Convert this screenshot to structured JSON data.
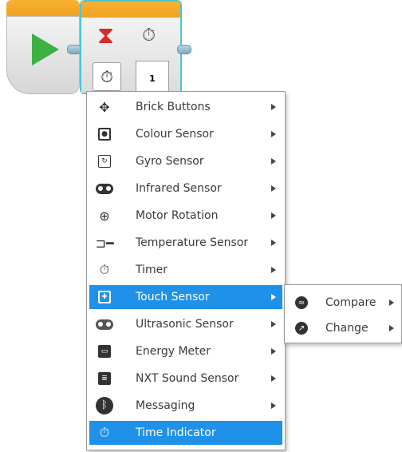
{
  "program": {
    "wait_block_param": "1",
    "colors": {
      "start_green": "#3cb043",
      "block_orange": "#f0a020",
      "selection": "#46c7d6"
    }
  },
  "menu": {
    "items": [
      {
        "label": "Brick Buttons",
        "icon": "brick-buttons-icon",
        "submenu": true
      },
      {
        "label": "Colour Sensor",
        "icon": "colour-sensor-icon",
        "submenu": true
      },
      {
        "label": "Gyro Sensor",
        "icon": "gyro-sensor-icon",
        "submenu": true
      },
      {
        "label": "Infrared Sensor",
        "icon": "infrared-sensor-icon",
        "submenu": true
      },
      {
        "label": "Motor Rotation",
        "icon": "motor-rotation-icon",
        "submenu": true
      },
      {
        "label": "Temperature Sensor",
        "icon": "temperature-sensor-icon",
        "submenu": true
      },
      {
        "label": "Timer",
        "icon": "timer-icon",
        "submenu": true
      },
      {
        "label": "Touch Sensor",
        "icon": "touch-sensor-icon",
        "submenu": true,
        "highlighted": true
      },
      {
        "label": "Ultrasonic Sensor",
        "icon": "ultrasonic-sensor-icon",
        "submenu": true
      },
      {
        "label": "Energy Meter",
        "icon": "energy-meter-icon",
        "submenu": true
      },
      {
        "label": "NXT Sound Sensor",
        "icon": "nxt-sound-sensor-icon",
        "submenu": true
      },
      {
        "label": "Messaging",
        "icon": "bluetooth-icon",
        "submenu": true
      },
      {
        "label": "Time Indicator",
        "icon": "time-indicator-icon",
        "submenu": false,
        "highlighted": true
      }
    ],
    "highlight_color": "#1f91e8"
  },
  "submenu": {
    "items": [
      {
        "label": "Compare",
        "icon": "compare-icon"
      },
      {
        "label": "Change",
        "icon": "change-icon"
      }
    ]
  }
}
